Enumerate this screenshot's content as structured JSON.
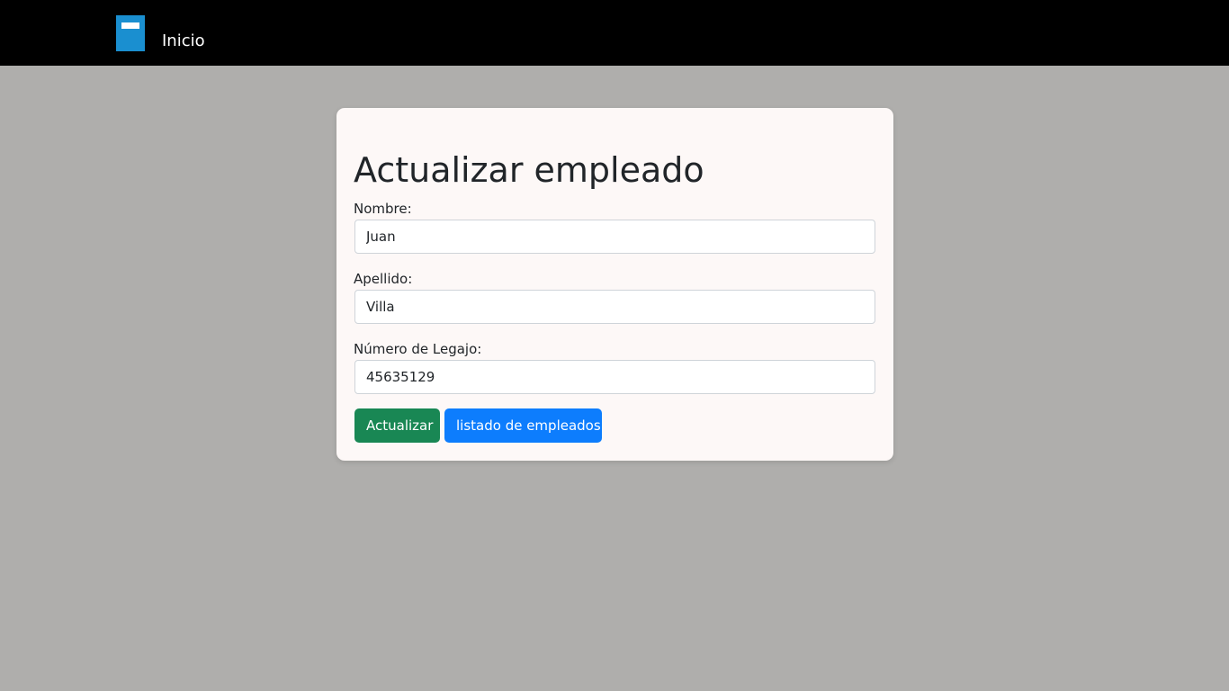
{
  "navbar": {
    "brand_icon": "book-icon",
    "link_label": "Inicio",
    "background": "#000000",
    "icon_color": "#1a8fd0"
  },
  "form": {
    "title": "Actualizar empleado",
    "fields": [
      {
        "label": "Nombre:",
        "value": "Juan"
      },
      {
        "label": "Apellido:",
        "value": "Villa"
      },
      {
        "label": "Número de Legajo:",
        "value": "45635129"
      }
    ],
    "buttons": {
      "update_label": "Actualizar",
      "list_label": "listado de empleados"
    }
  },
  "colors": {
    "page_background": "#afaeac",
    "card_background": "#fdf8f7",
    "update_button": "#198754",
    "list_button": "#0d7dfd"
  }
}
